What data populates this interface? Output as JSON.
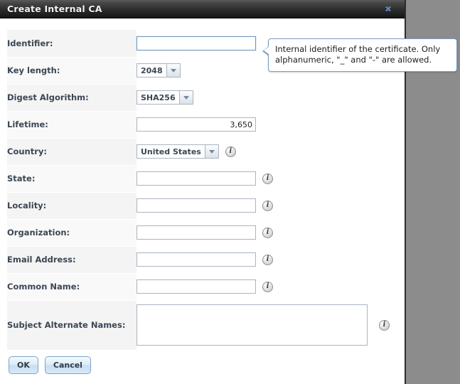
{
  "window": {
    "title": "Create Internal CA",
    "close_label": "✖",
    "close_icon": "close-icon"
  },
  "form": {
    "rows": [
      {
        "label": "Identifier:",
        "control": "text",
        "value": "",
        "focused": true,
        "info": false
      },
      {
        "label": "Key length:",
        "control": "combo",
        "value": "2048",
        "info": false
      },
      {
        "label": "Digest Algorithm:",
        "control": "combo",
        "value": "SHA256",
        "info": false
      },
      {
        "label": "Lifetime:",
        "control": "number",
        "value": "3,650",
        "info": false
      },
      {
        "label": "Country:",
        "control": "combo",
        "value": "United States",
        "info": true
      },
      {
        "label": "State:",
        "control": "text",
        "value": "",
        "info": true
      },
      {
        "label": "Locality:",
        "control": "text",
        "value": "",
        "info": true
      },
      {
        "label": "Organization:",
        "control": "text",
        "value": "",
        "info": true
      },
      {
        "label": "Email Address:",
        "control": "text",
        "value": "",
        "info": true
      },
      {
        "label": "Common Name:",
        "control": "text",
        "value": "",
        "info": true
      },
      {
        "label": "Subject Alternate Names:",
        "control": "textarea",
        "value": "",
        "info": true
      }
    ],
    "info_glyph": "i"
  },
  "tooltip": {
    "text": "Internal identifier of the certificate. Only alphanumeric, \"_\" and \"-\" are allowed.",
    "target": "Identifier:"
  },
  "footer": {
    "ok_label": "OK",
    "cancel_label": "Cancel"
  },
  "colors": {
    "titlebar_dark": "#1d1d1d",
    "backdrop": "#8c8c8c",
    "tooltip_border": "#7a9cc0",
    "label_bg": "#f4f4f4",
    "accent": "#7ba2c9"
  }
}
